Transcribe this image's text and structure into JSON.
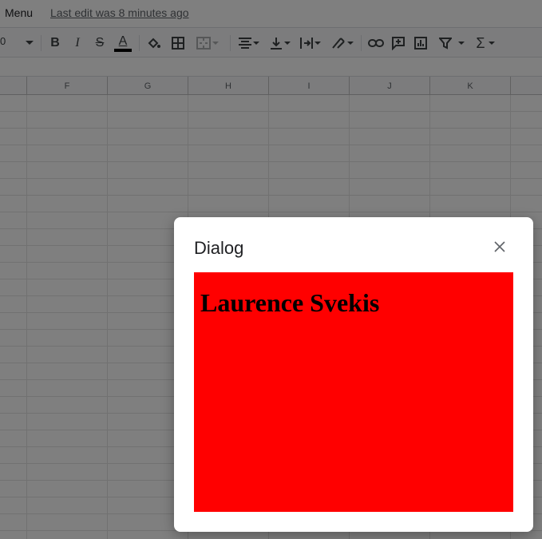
{
  "menubar": {
    "menu_label": "Menu",
    "last_edit": "Last edit was 8 minutes ago"
  },
  "toolbar": {
    "font_size": "0",
    "icons": [
      "chevron-down",
      "bold",
      "italic",
      "strikethrough",
      "text-color",
      "fill-color",
      "borders",
      "merge-cells",
      "horizontal-align",
      "vertical-align",
      "text-wrap",
      "text-rotation",
      "insert-link",
      "insert-comment",
      "insert-chart",
      "filter",
      "functions"
    ],
    "bold_label": "B",
    "italic_label": "I",
    "strike_label": "S",
    "textcolor_label": "A",
    "sigma_label": "Σ"
  },
  "columns": [
    "F",
    "G",
    "H",
    "I",
    "J",
    "K"
  ],
  "dialog": {
    "title": "Dialog",
    "close_label": "×",
    "content_heading": "Laurence Svekis",
    "content_background": "#ff0000"
  },
  "colors": {
    "overlay": "rgba(0,0,0,0.5)",
    "dialog_bg": "#ffffff",
    "text_color_bar": "#000000"
  }
}
